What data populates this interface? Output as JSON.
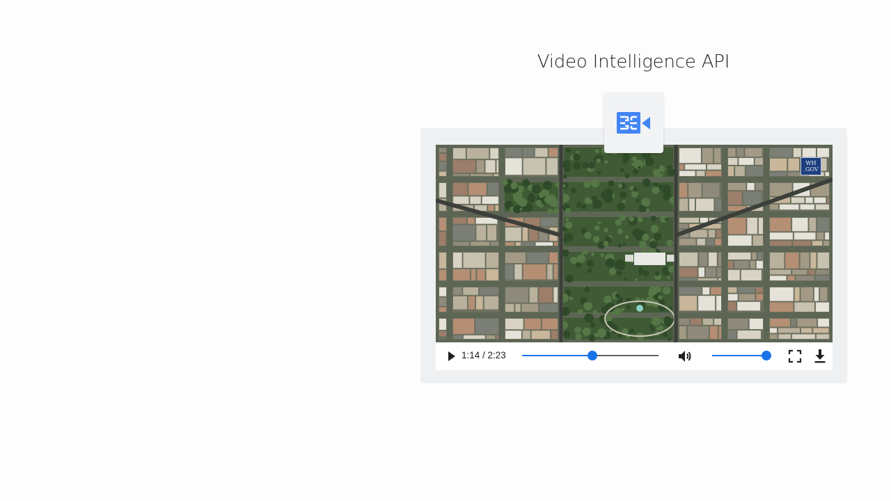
{
  "header": {
    "title": "Video Intelligence API"
  },
  "product_icon": {
    "name": "video-intelligence-icon",
    "color": "#4285f4"
  },
  "video": {
    "watermark_line1": "WH",
    "watermark_line2": ".GOV",
    "content": "aerial-satellite-map"
  },
  "player": {
    "time_display": "1:14 / 2:23",
    "elapsed": "1:14",
    "duration": "2:23",
    "progress": 0.517,
    "volume": 0.98,
    "accent_color": "#1a73e8",
    "icons": {
      "play": "play-icon",
      "volume": "volume-icon",
      "fullscreen": "fullscreen-icon",
      "download": "download-icon"
    }
  }
}
